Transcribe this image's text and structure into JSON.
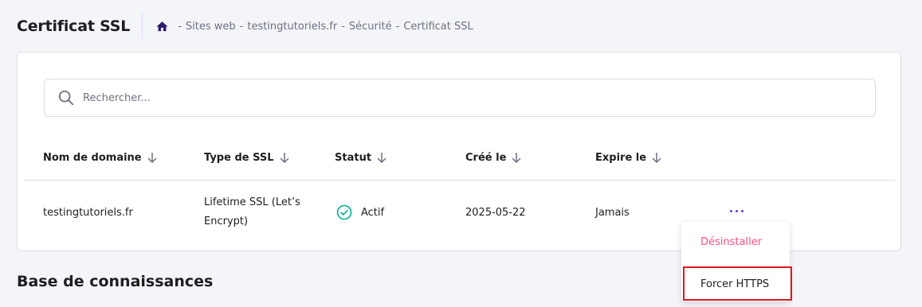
{
  "header": {
    "title": "Certificat SSL",
    "breadcrumb": [
      "Sites web",
      "testingtutoriels.fr",
      "Sécurité",
      "Certificat SSL"
    ],
    "separator": "-"
  },
  "search": {
    "placeholder": "Rechercher..."
  },
  "table": {
    "columns": [
      "Nom de domaine",
      "Type de SSL",
      "Statut",
      "Créé le",
      "Expire le"
    ],
    "rows": [
      {
        "domain": "testingtutoriels.fr",
        "ssl_type": "Lifetime SSL (Let’s Encrypt)",
        "status": "Actif",
        "created": "2025-05-22",
        "expires": "Jamais"
      }
    ]
  },
  "menu": {
    "items": [
      "Désinstaller",
      "Forcer HTTPS"
    ]
  },
  "knowledge": {
    "title": "Base de connaissances"
  },
  "colors": {
    "accent": "#673de6",
    "danger": "#fc5185",
    "success": "#00b090",
    "highlight": "#e0171f"
  },
  "icons": [
    "home-icon",
    "search-icon",
    "sort-arrow-icon",
    "check-circle-icon",
    "more-dots-icon"
  ]
}
